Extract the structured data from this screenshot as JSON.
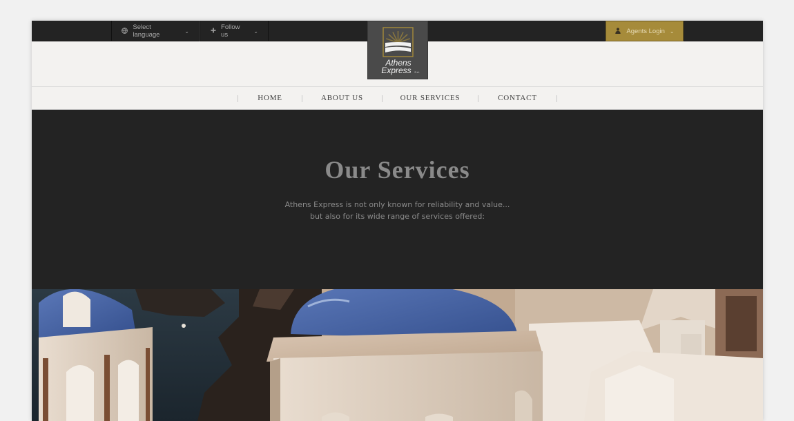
{
  "topbar": {
    "language": {
      "label": "Select language",
      "icon": "globe-icon"
    },
    "follow": {
      "label": "Follow us",
      "icon": "plus-icon"
    },
    "agents": {
      "label": "Agents Login",
      "icon": "user-icon"
    }
  },
  "logo": {
    "line1": "Athens",
    "line2": "Express",
    "suffix": "S.A."
  },
  "nav": {
    "items": [
      {
        "label": "HOME"
      },
      {
        "label": "ABOUT US"
      },
      {
        "label": "OUR SERVICES"
      },
      {
        "label": "CONTACT"
      }
    ]
  },
  "hero": {
    "title": "Our Services",
    "line1": "Athens Express is not only known for reliability and value...",
    "line2": "but also for its wide range of services offered:"
  },
  "colors": {
    "topbar": "#232323",
    "accent_gold": "#a68b3a",
    "hero_bg": "#232323",
    "page_bg": "#f3f2f0"
  }
}
